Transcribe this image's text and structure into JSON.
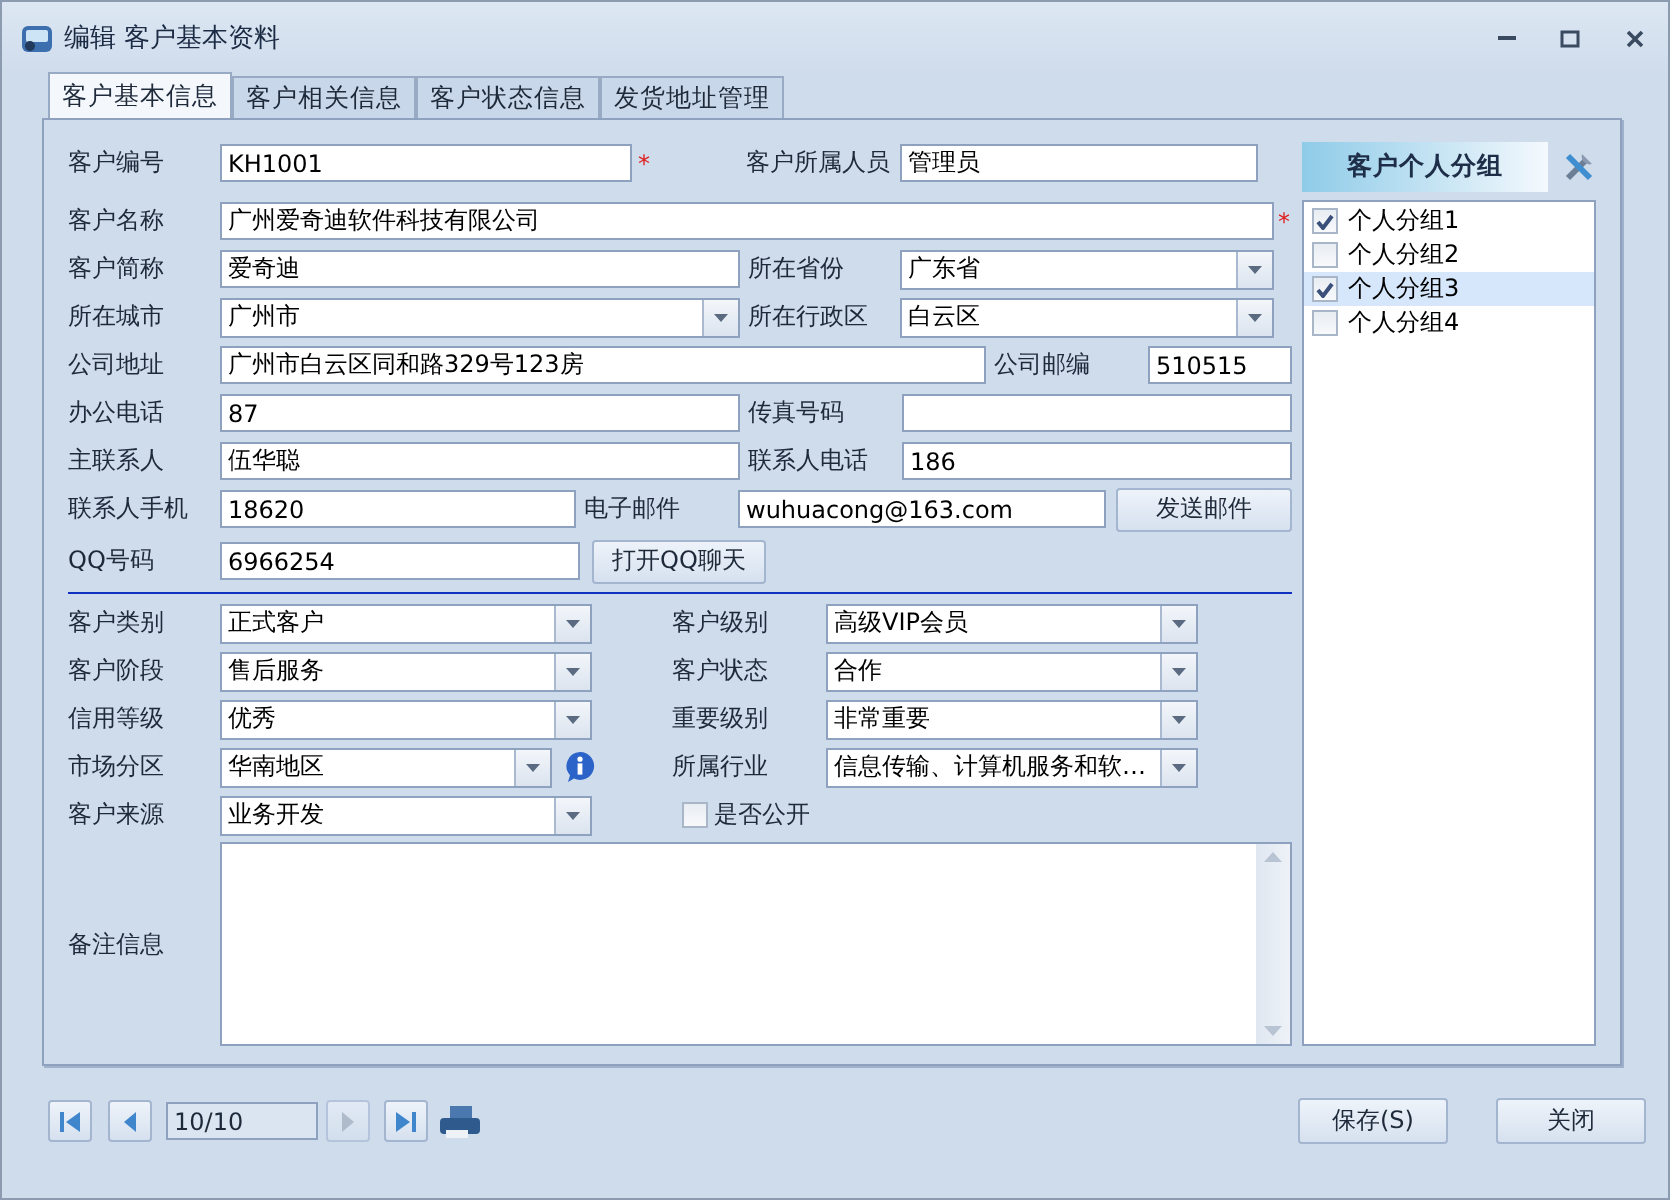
{
  "window": {
    "title": "编辑 客户基本资料"
  },
  "tabs": [
    {
      "label": "客户基本信息",
      "selected": true
    },
    {
      "label": "客户相关信息",
      "selected": false
    },
    {
      "label": "客户状态信息",
      "selected": false
    },
    {
      "label": "发货地址管理",
      "selected": false
    }
  ],
  "contact_rows": [
    {
      "items": [
        {
          "kind": "label",
          "text": "客户编号"
        },
        {
          "kind": "text",
          "value": "KH1001"
        },
        {
          "kind": "mark",
          "text": "*"
        },
        {
          "kind": "label",
          "text": "客户所属人员"
        },
        {
          "kind": "text",
          "value": "管理员"
        }
      ]
    },
    {
      "items": [
        {
          "kind": "label",
          "text": "客户名称"
        },
        {
          "kind": "text",
          "value": "广州爱奇迪软件科技有限公司"
        },
        {
          "kind": "mark",
          "text": "*"
        }
      ]
    },
    {
      "items": [
        {
          "kind": "label",
          "text": "客户简称"
        },
        {
          "kind": "text",
          "value": "爱奇迪"
        },
        {
          "kind": "label",
          "text": "所在省份"
        },
        {
          "kind": "combo",
          "value": "广东省"
        }
      ]
    },
    {
      "items": [
        {
          "kind": "label",
          "text": "所在城市"
        },
        {
          "kind": "combo",
          "value": "广州市"
        },
        {
          "kind": "label",
          "text": "所在行政区"
        },
        {
          "kind": "combo",
          "value": "白云区"
        }
      ]
    },
    {
      "items": [
        {
          "kind": "label",
          "text": "公司地址"
        },
        {
          "kind": "text",
          "value": "广州市白云区同和路329号123房"
        },
        {
          "kind": "label",
          "text": "公司邮编"
        },
        {
          "kind": "text",
          "value": "510515"
        }
      ]
    },
    {
      "items": [
        {
          "kind": "label",
          "text": "办公电话"
        },
        {
          "kind": "text",
          "value": "87"
        },
        {
          "kind": "label",
          "text": "传真号码"
        },
        {
          "kind": "text"
        }
      ]
    },
    {
      "items": [
        {
          "kind": "label",
          "text": "主联系人"
        },
        {
          "kind": "text",
          "value": "伍华聪"
        },
        {
          "kind": "label",
          "text": "联系人电话"
        },
        {
          "kind": "text",
          "value": "186"
        }
      ]
    },
    {
      "items": [
        {
          "kind": "label",
          "text": "联系人手机"
        },
        {
          "kind": "text",
          "value": "18620"
        },
        {
          "kind": "label",
          "text": "电子邮件"
        },
        {
          "kind": "text",
          "value": "wuhuacong@163.com"
        },
        {
          "kind": "button",
          "text": "发送邮件"
        }
      ]
    },
    {
      "items": [
        {
          "kind": "label",
          "text": "QQ号码"
        },
        {
          "kind": "text",
          "value": "6966254"
        },
        {
          "kind": "button",
          "text": "打开QQ聊天"
        }
      ]
    }
  ],
  "class_rows": [
    {
      "items": [
        {
          "kind": "label",
          "text": "客户类别"
        },
        {
          "kind": "combo",
          "value": "正式客户"
        },
        {
          "kind": "label",
          "text": "客户级别"
        },
        {
          "kind": "combo",
          "value": "高级VIP会员"
        }
      ]
    },
    {
      "items": [
        {
          "kind": "label",
          "text": "客户阶段"
        },
        {
          "kind": "combo",
          "value": "售后服务"
        },
        {
          "kind": "label",
          "text": "客户状态"
        },
        {
          "kind": "combo",
          "value": "合作"
        }
      ]
    },
    {
      "items": [
        {
          "kind": "label",
          "text": "信用等级"
        },
        {
          "kind": "combo",
          "value": "优秀"
        },
        {
          "kind": "label",
          "text": "重要级别"
        },
        {
          "kind": "combo",
          "value": "非常重要"
        }
      ]
    },
    {
      "items": [
        {
          "kind": "label",
          "text": "市场分区"
        },
        {
          "kind": "combo",
          "value": "华南地区"
        },
        {
          "kind": "info"
        },
        {
          "kind": "label",
          "text": "所属行业"
        },
        {
          "kind": "combo",
          "value": "信息传输、计算机服务和软…"
        }
      ]
    },
    {
      "items": [
        {
          "kind": "label",
          "text": "客户来源"
        },
        {
          "kind": "combo",
          "value": "业务开发"
        },
        {
          "kind": "checkbox",
          "text": "是否公开",
          "checked": false
        }
      ]
    }
  ],
  "remarks": {
    "label": "备注信息"
  },
  "groups": {
    "title": "客户个人分组",
    "items": [
      {
        "label": "个人分组1",
        "checked": true,
        "selected": false
      },
      {
        "label": "个人分组2",
        "checked": false,
        "selected": false
      },
      {
        "label": "个人分组3",
        "checked": true,
        "selected": true
      },
      {
        "label": "个人分组4",
        "checked": false,
        "selected": false
      }
    ]
  },
  "pager": {
    "position": "10/10"
  },
  "buttons": [
    {
      "label": "保存(S)"
    },
    {
      "label": "关闭"
    }
  ]
}
